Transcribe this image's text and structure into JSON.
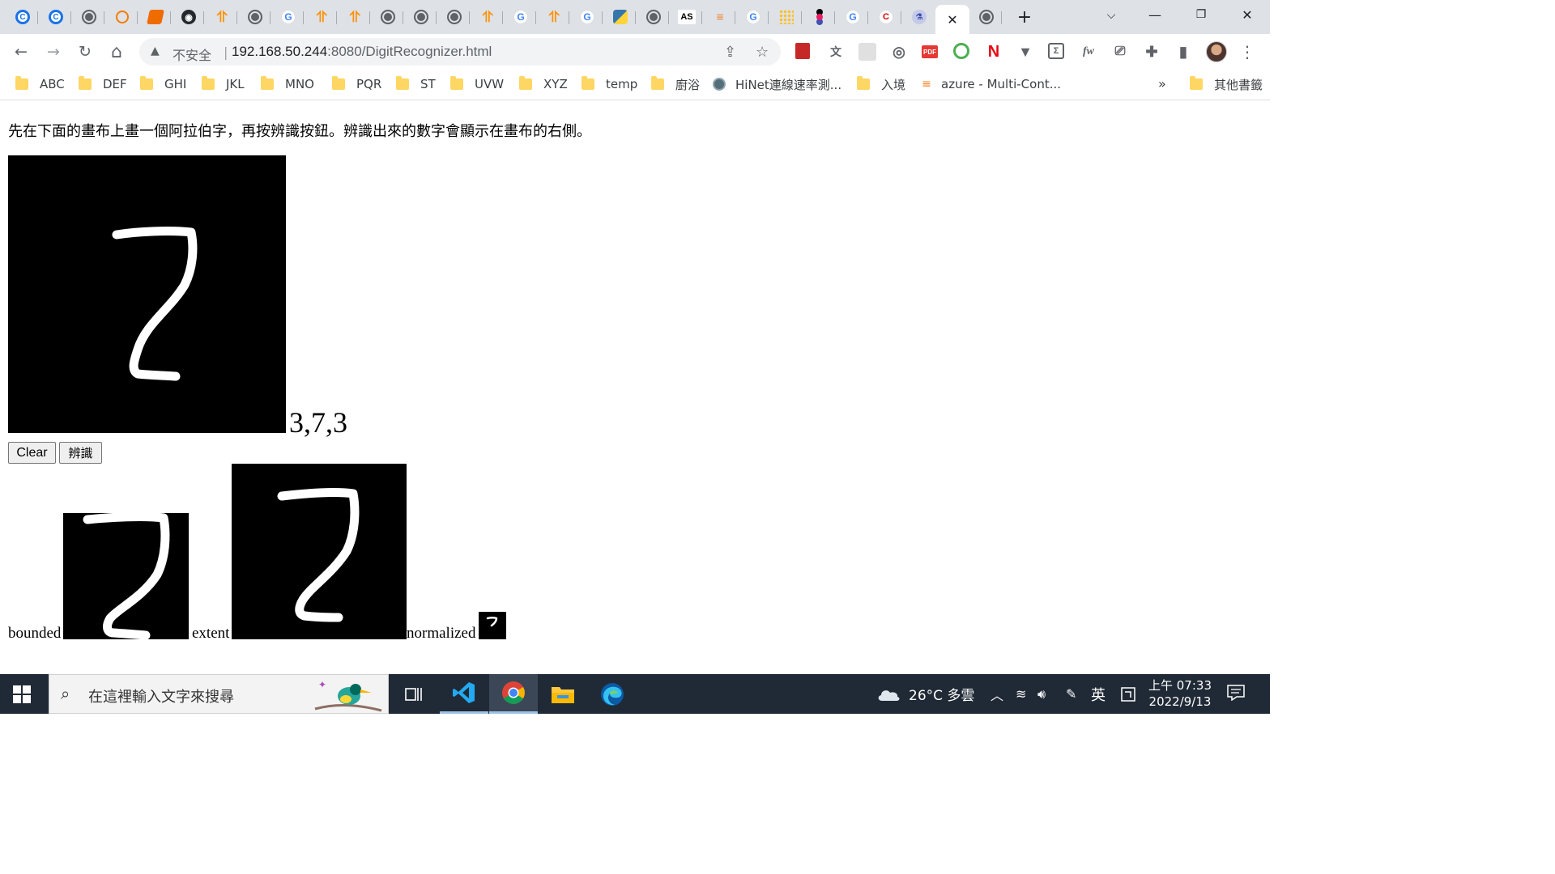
{
  "browser": {
    "tabs": [
      {
        "icon": "chrome-c"
      },
      {
        "icon": "chrome-c"
      },
      {
        "icon": "globe"
      },
      {
        "icon": "orange-ring"
      },
      {
        "icon": "orange-book"
      },
      {
        "icon": "github"
      },
      {
        "icon": "tensorflow"
      },
      {
        "icon": "globe"
      },
      {
        "icon": "google"
      },
      {
        "icon": "tensorflow"
      },
      {
        "icon": "tensorflow"
      },
      {
        "icon": "globe"
      },
      {
        "icon": "globe"
      },
      {
        "icon": "globe"
      },
      {
        "icon": "tensorflow"
      },
      {
        "icon": "google"
      },
      {
        "icon": "tensorflow"
      },
      {
        "icon": "google"
      },
      {
        "icon": "python"
      },
      {
        "icon": "globe-crossed"
      },
      {
        "icon": "as"
      },
      {
        "icon": "stackoverflow"
      },
      {
        "icon": "google"
      },
      {
        "icon": "dots"
      },
      {
        "icon": "pin"
      },
      {
        "icon": "google"
      },
      {
        "icon": "red-c"
      },
      {
        "icon": "flask"
      },
      {
        "icon": "close",
        "active": true
      },
      {
        "icon": "globe"
      }
    ],
    "new_tab": "+",
    "window_controls": {
      "minimize": "—",
      "restore": "❐",
      "close": "✕"
    }
  },
  "toolbar": {
    "back": "←",
    "forward": "→",
    "reload": "↻",
    "home": "⌂",
    "security_icon": "▲",
    "security_label": "不安全",
    "url_host": "192.168.50.244",
    "url_rest": ":8080/DigitRecognizer.html",
    "share": "⇪",
    "star": "☆",
    "menu": "⋮"
  },
  "bookmarks": [
    {
      "label": "ABC",
      "icon": "folder"
    },
    {
      "label": "DEF",
      "icon": "folder"
    },
    {
      "label": "GHI",
      "icon": "folder"
    },
    {
      "label": "JKL",
      "icon": "folder"
    },
    {
      "label": "MNO",
      "icon": "folder"
    },
    {
      "label": "PQR",
      "icon": "folder"
    },
    {
      "label": "ST",
      "icon": "folder"
    },
    {
      "label": "UVW",
      "icon": "folder"
    },
    {
      "label": "XYZ",
      "icon": "folder"
    },
    {
      "label": "temp",
      "icon": "folder"
    },
    {
      "label": "廚浴",
      "icon": "folder"
    },
    {
      "label": "HiNet連線速率測...",
      "icon": "globe"
    },
    {
      "label": "入境",
      "icon": "folder"
    },
    {
      "label": "azure - Multi-Cont...",
      "icon": "stackoverflow"
    }
  ],
  "bookmarks_more": "»",
  "bookmarks_other": "其他書籤",
  "page": {
    "instructions": "先在下面的畫布上畫一個阿拉伯字，再按辨識按鈕。辨識出來的數字會顯示在畫布的右側。",
    "result": "3,7,3",
    "clear_button": "Clear",
    "recognize_button": "辨識",
    "label_bounded": "bounded",
    "label_extent": "extent",
    "label_normalized": "normalized"
  },
  "taskbar": {
    "search_placeholder": "在這裡輸入文字來搜尋",
    "weather": "26°C 多雲",
    "ime": "英",
    "time": "上午 07:33",
    "date": "2022/9/13"
  }
}
